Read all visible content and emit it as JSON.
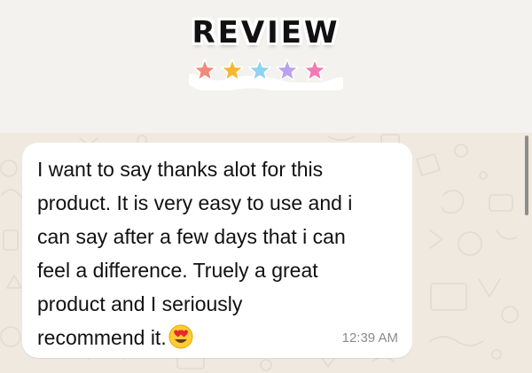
{
  "sticker": {
    "title": "REVIEW",
    "stars": [
      {
        "color": "#f08a7a"
      },
      {
        "color": "#f7b733"
      },
      {
        "color": "#8fd3f0"
      },
      {
        "color": "#b9a3f0"
      },
      {
        "color": "#f27ab5"
      }
    ]
  },
  "message": {
    "text": "I want to say thanks alot for this\nproduct. It is very easy to use and i\ncan say after a few days that i can\nfeel a difference. Truely a great\nproduct and I seriously\nrecommend it.",
    "emoji": "smiling-face-with-heart-eyes",
    "time": "12:39 AM"
  }
}
